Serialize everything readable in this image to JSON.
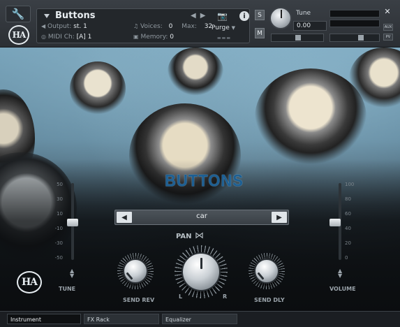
{
  "header": {
    "instrument_title": "Buttons",
    "output_label": "Output:",
    "output_value": "st. 1",
    "midi_label": "MIDI Ch:",
    "midi_value": "[A] 1",
    "voices_label": "Voices:",
    "voices_value": "0",
    "max_label": "Max:",
    "max_value": "32",
    "memory_label": "Memory:",
    "memory_value": "0",
    "purge_label": "Purge",
    "solo_label": "S",
    "mute_label": "M",
    "tune_label": "Tune",
    "tune_value": "0.00",
    "aux_label": "AUX",
    "pv_label": "PV"
  },
  "main": {
    "brand_title": "BUTTONS",
    "preset_name": "car",
    "pan_label": "PAN",
    "left_marker": "L",
    "right_marker": "R",
    "send_rev_label": "SEND REV",
    "send_dly_label": "SEND DLY",
    "tune_slider_label": "TUNE",
    "volume_slider_label": "VOLUME",
    "tune_scale": [
      "50",
      "30",
      "10",
      "-10",
      "-30",
      "-50"
    ],
    "volume_scale": [
      "100",
      "80",
      "60",
      "40",
      "20",
      "0"
    ],
    "logo_text": "HA"
  },
  "tabs": [
    {
      "label": "Instrument",
      "active": true
    },
    {
      "label": "FX Rack",
      "active": false
    },
    {
      "label": "Equalizer",
      "active": false
    }
  ],
  "colors": {
    "brand_title": "#1d5f93",
    "panel": "#23272b",
    "accent_knob": "#c9cfd4"
  }
}
